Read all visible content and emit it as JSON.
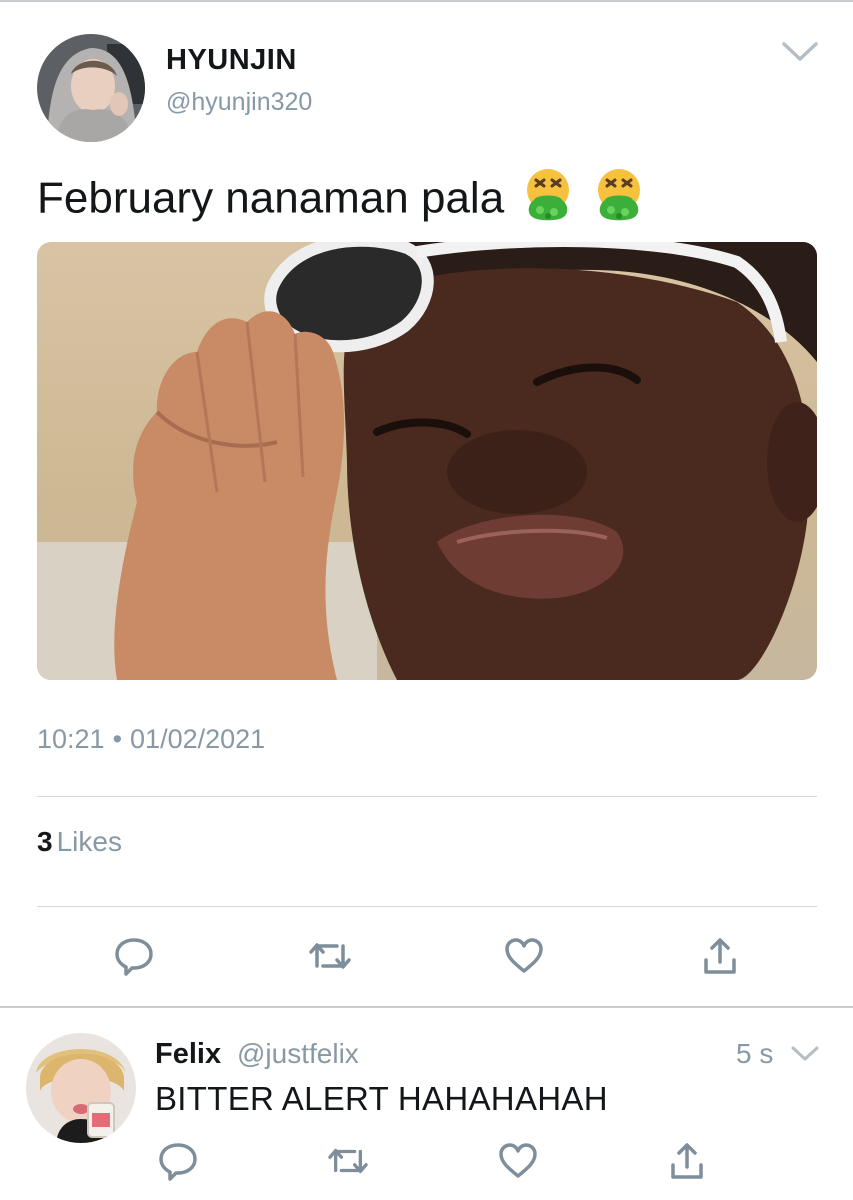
{
  "tweet": {
    "display_name": "HYUNJIN",
    "handle": "@hyunjin320",
    "text": "February nanaman pala",
    "emojis": [
      "vomiting-face-emoji",
      "vomiting-face-emoji"
    ],
    "time": "10:21",
    "separator": "•",
    "date": "01/02/2021",
    "likes_count": "3",
    "likes_label": "Likes"
  },
  "reply": {
    "display_name": "Felix",
    "handle": "@justfelix",
    "time": "5 s",
    "text": "BITTER ALERT HAHAHAHAH"
  },
  "icons": {
    "actions": [
      "reply-icon",
      "retweet-icon",
      "like-icon",
      "share-icon"
    ],
    "menu": "chevron-down-icon"
  },
  "colors": {
    "text": "#14171a",
    "secondary": "#8899a6",
    "icon": "#7e8e9a",
    "divider": "#d5d9dd"
  }
}
